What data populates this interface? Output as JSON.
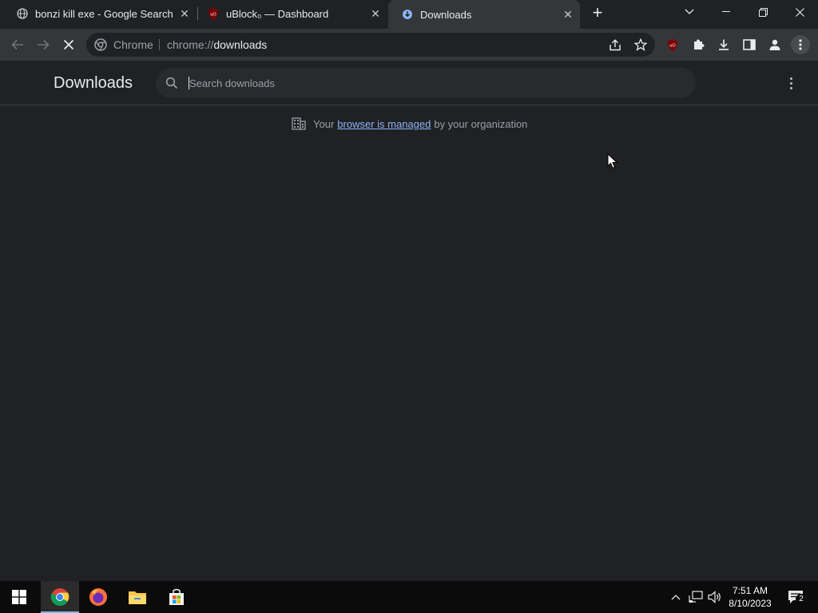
{
  "tabs": [
    {
      "title": "bonzi kill exe - Google Search",
      "favicon": "globe-icon"
    },
    {
      "title": "uBlock₀ — Dashboard",
      "favicon": "ublock-icon"
    },
    {
      "title": "Downloads",
      "favicon": "download-icon",
      "active": true
    }
  ],
  "omnibox": {
    "chip": "Chrome",
    "url_prefix": "chrome://",
    "url_host": "downloads"
  },
  "page": {
    "title": "Downloads",
    "search_placeholder": "Search downloads",
    "managed_prefix": "Your",
    "managed_link": "browser is managed",
    "managed_suffix": "by your organization"
  },
  "taskbar": {
    "apps": [
      "windows-start-icon",
      "chrome-icon",
      "firefox-icon",
      "file-explorer-icon",
      "store-icon"
    ],
    "time": "7:51 AM",
    "date": "8/10/2023",
    "notifications": "2"
  },
  "colors": {
    "accent": "#8ab4f8",
    "bg": "#202124",
    "toolbar": "#35363a"
  }
}
